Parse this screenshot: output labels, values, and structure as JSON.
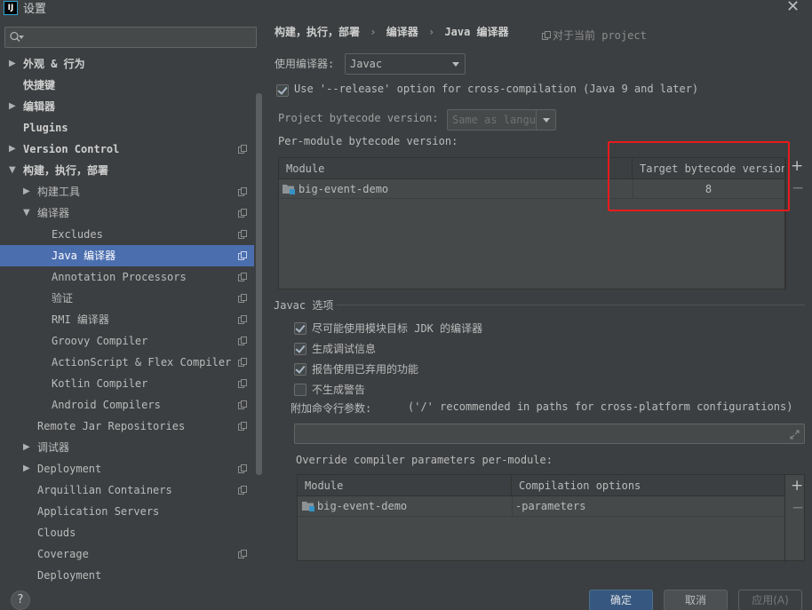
{
  "window": {
    "app_icon": "IJ",
    "title": "设置",
    "close_glyph": "✕"
  },
  "search": {
    "placeholder": "",
    "value": ""
  },
  "tree": [
    {
      "label": "外观 & 行为",
      "arrow": "▶",
      "bold": true,
      "copy": false
    },
    {
      "label": "快捷键",
      "arrow": "",
      "bold": true,
      "copy": false
    },
    {
      "label": "编辑器",
      "arrow": "▶",
      "bold": true,
      "copy": false
    },
    {
      "label": "Plugins",
      "arrow": "",
      "bold": true,
      "copy": false
    },
    {
      "label": "Version Control",
      "arrow": "▶",
      "bold": true,
      "copy": true
    },
    {
      "label": "构建，执行，部署",
      "arrow": "▼",
      "bold": true,
      "copy": false
    },
    {
      "label": "构建工具",
      "arrow": "▶",
      "bold": false,
      "copy": true
    },
    {
      "label": "编译器",
      "arrow": "▼",
      "bold": false,
      "copy": true
    },
    {
      "label": "Excludes",
      "arrow": "",
      "bold": false,
      "copy": true
    },
    {
      "label": "Java 编译器",
      "arrow": "",
      "bold": false,
      "copy": true,
      "selected": true
    },
    {
      "label": "Annotation Processors",
      "arrow": "",
      "bold": false,
      "copy": true
    },
    {
      "label": "验证",
      "arrow": "",
      "bold": false,
      "copy": true
    },
    {
      "label": "RMI 编译器",
      "arrow": "",
      "bold": false,
      "copy": true
    },
    {
      "label": "Groovy Compiler",
      "arrow": "",
      "bold": false,
      "copy": true
    },
    {
      "label": "ActionScript & Flex Compiler",
      "arrow": "",
      "bold": false,
      "copy": true
    },
    {
      "label": "Kotlin Compiler",
      "arrow": "",
      "bold": false,
      "copy": true
    },
    {
      "label": "Android Compilers",
      "arrow": "",
      "bold": false,
      "copy": true
    },
    {
      "label": "Remote Jar Repositories",
      "arrow": "",
      "bold": false,
      "copy": true
    },
    {
      "label": "调试器",
      "arrow": "▶",
      "bold": false,
      "copy": false
    },
    {
      "label": "Deployment",
      "arrow": "▶",
      "bold": false,
      "copy": true
    },
    {
      "label": "Arquillian Containers",
      "arrow": "",
      "bold": false,
      "copy": true
    },
    {
      "label": "Application Servers",
      "arrow": "",
      "bold": false,
      "copy": false
    },
    {
      "label": "Clouds",
      "arrow": "",
      "bold": false,
      "copy": false
    },
    {
      "label": "Coverage",
      "arrow": "",
      "bold": false,
      "copy": true
    },
    {
      "label": "Deployment",
      "arrow": "",
      "bold": false,
      "copy": false
    }
  ],
  "breadcrumb": {
    "part1": "构建，执行，部署",
    "sep1": "›",
    "part2": "编译器",
    "sep2": "›",
    "part3": "Java 编译器"
  },
  "scope_label": "对于当前 project",
  "compiler": {
    "label": "使用编译器:",
    "value": "Javac"
  },
  "release_option": {
    "checked": true,
    "label": "Use '--release' option for cross-compilation (Java 9 and later)"
  },
  "project_bytecode": {
    "label": "Project bytecode version:",
    "value": "Same as langu"
  },
  "per_module": {
    "label": "Per-module bytecode version:",
    "columns": [
      "Module",
      "Target bytecode version"
    ],
    "rows": [
      {
        "module": "big-event-demo",
        "version": "8"
      }
    ],
    "add": "+",
    "remove": "−"
  },
  "javac": {
    "section_title": "Javac 选项",
    "options": [
      {
        "label": "尽可能使用模块目标 JDK 的编译器",
        "checked": true
      },
      {
        "label": "生成调试信息",
        "checked": true
      },
      {
        "label": "报告使用已弃用的功能",
        "checked": true
      },
      {
        "label": "不生成警告",
        "checked": false
      }
    ],
    "extra_params_label": "附加命令行参数:",
    "extra_params_hint": "('/' recommended in paths for cross-platform configurations)",
    "extra_params_value": ""
  },
  "override": {
    "label": "Override compiler parameters per-module:",
    "columns": [
      "Module",
      "Compilation options"
    ],
    "rows": [
      {
        "module": "big-event-demo",
        "options": "-parameters"
      }
    ],
    "add": "+",
    "remove": "−"
  },
  "buttons": {
    "help": "?",
    "ok": "确定",
    "cancel": "取消",
    "apply": "应用(A)"
  },
  "colors": {
    "background": "#3c3f41",
    "selection": "#4b6eaf",
    "highlight_box": "#e81b1b",
    "primary_button": "#365880"
  }
}
